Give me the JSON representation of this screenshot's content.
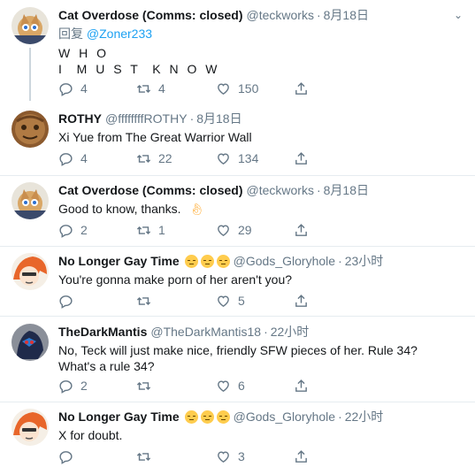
{
  "tweets": [
    {
      "name": "Cat Overdose (Comms: closed)",
      "handle": "@teckworks",
      "time": "8月18日",
      "reply_prefix": "回复",
      "reply_to": "@Zoner233",
      "line1": "W H O",
      "line2": "I  M U S T  K N O W",
      "replies": "4",
      "retweets": "4",
      "likes": "150"
    },
    {
      "name": "ROTHY",
      "handle": "@ffffffffROTHY",
      "time": "8月18日",
      "text": "Xi Yue from The Great Warrior Wall",
      "replies": "4",
      "retweets": "22",
      "likes": "134"
    },
    {
      "name": "Cat Overdose (Comms: closed)",
      "handle": "@teckworks",
      "time": "8月18日",
      "text": "Good to know, thanks.",
      "replies": "2",
      "retweets": "1",
      "likes": "29"
    },
    {
      "name": "No Longer Gay Time",
      "handle": "@Gods_Gloryhole",
      "time": "23小时",
      "text": "You're gonna make porn of her aren't you?",
      "replies": "",
      "retweets": "",
      "likes": "5"
    },
    {
      "name": "TheDarkMantis",
      "handle": "@TheDarkMantis18",
      "time": "22小时",
      "text": "No, Teck will just make nice, friendly SFW pieces of her. Rule 34? What's a rule 34?",
      "replies": "2",
      "retweets": "",
      "likes": "6"
    },
    {
      "name": "No Longer Gay Time",
      "handle": "@Gods_Gloryhole",
      "time": "22小时",
      "text": "X for doubt.",
      "replies": "",
      "retweets": "",
      "likes": "3"
    }
  ],
  "icons": {
    "reply": "reply-icon",
    "retweet": "retweet-icon",
    "like": "heart-icon",
    "share": "share-icon",
    "caret": "chevron-down-icon"
  },
  "colors": {
    "text": "#14171a",
    "secondary": "#657786",
    "link": "#1da1f2",
    "border": "#e6ecf0",
    "thread_line": "#ccd6dd"
  }
}
